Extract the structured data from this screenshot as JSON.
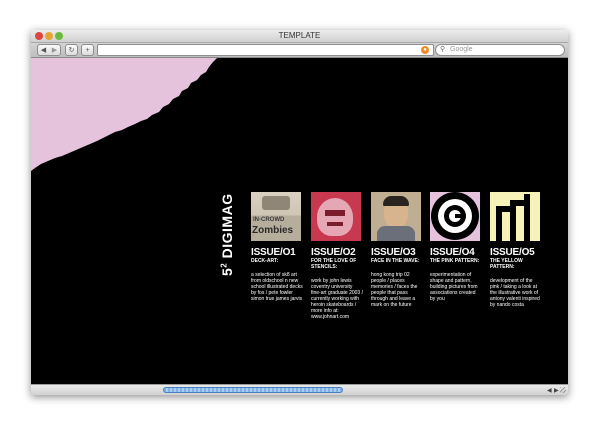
{
  "window": {
    "title": "TEMPLATE"
  },
  "toolbar": {
    "back_icon": "back-arrow-icon",
    "forward_icon": "forward-arrow-icon",
    "reload_icon": "reload-icon",
    "add_icon": "plus-icon",
    "search_placeholder": "Google"
  },
  "brand": {
    "name": "5",
    "exponent": "2",
    "suffix": " DIGIMAG"
  },
  "colors": {
    "pink": "#e6c3dd",
    "cream": "#f7f2b8",
    "black": "#000000"
  },
  "issues": [
    {
      "title": "ISSUE/O1",
      "subtitle": "DECK-ART:",
      "description": "a selection of sk8 art from oldschool n new school illustrated decks by fos / pete fowler simon true james jarvis",
      "thumb_text1": "IN-CROWD",
      "thumb_text2": "Zombies"
    },
    {
      "title": "ISSUE/O2",
      "subtitle": "FOR THE LOVE OF STENCILS:",
      "description": "work by john lewis coventry university fine-art graduate 2003 / currently working with heroin skateboards / more info at: www.johnart.com"
    },
    {
      "title": "ISSUE/O3",
      "subtitle": "FACE IN THE WAVE:",
      "description": "hong kong trip 02 people / places memories / faces the people that pass through and leave a mark on the future"
    },
    {
      "title": "ISSUE/O4",
      "subtitle": "THE PINK PATTERN:",
      "description": "experimentation of shape and pattern, building pictures from associations created by you"
    },
    {
      "title": "ISSUE/O5",
      "subtitle": "THE YELLOW PATTERN:",
      "description": "development of the pink / taking a look at the illustrative work of antony valenti inspired by nando costa"
    }
  ]
}
